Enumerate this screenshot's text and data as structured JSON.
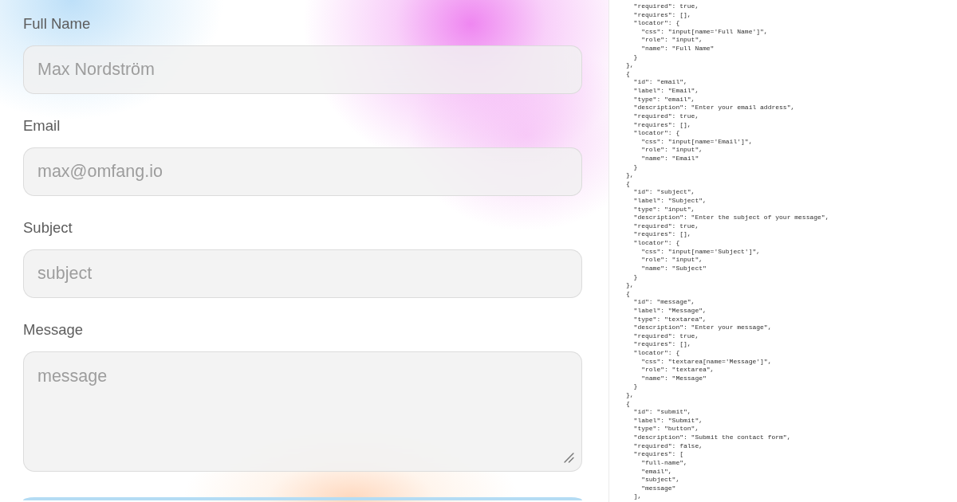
{
  "form": {
    "fields": [
      {
        "label": "Full Name",
        "kind": "input",
        "placeholder": "Max Nordström"
      },
      {
        "label": "Email",
        "kind": "input",
        "placeholder": "max@omfang.io"
      },
      {
        "label": "Subject",
        "kind": "input",
        "placeholder": "subject"
      },
      {
        "label": "Message",
        "kind": "textarea",
        "placeholder": "message"
      }
    ]
  },
  "code_panel": {
    "lines": [
      "  \"required\": true,",
      "  \"requires\": [],",
      "  \"locator\": {",
      "    \"css\": \"input[name='Full Name']\",",
      "    \"role\": \"input\",",
      "    \"name\": \"Full Name\"",
      "  }",
      "},",
      "{",
      "  \"id\": \"email\",",
      "  \"label\": \"Email\",",
      "  \"type\": \"email\",",
      "  \"description\": \"Enter your email address\",",
      "  \"required\": true,",
      "  \"requires\": [],",
      "  \"locator\": {",
      "    \"css\": \"input[name='Email']\",",
      "    \"role\": \"input\",",
      "    \"name\": \"Email\"",
      "  }",
      "},",
      "{",
      "  \"id\": \"subject\",",
      "  \"label\": \"Subject\",",
      "  \"type\": \"input\",",
      "  \"description\": \"Enter the subject of your message\",",
      "  \"required\": true,",
      "  \"requires\": [],",
      "  \"locator\": {",
      "    \"css\": \"input[name='Subject']\",",
      "    \"role\": \"input\",",
      "    \"name\": \"Subject\"",
      "  }",
      "},",
      "{",
      "  \"id\": \"message\",",
      "  \"label\": \"Message\",",
      "  \"type\": \"textarea\",",
      "  \"description\": \"Enter your message\",",
      "  \"required\": true,",
      "  \"requires\": [],",
      "  \"locator\": {",
      "    \"css\": \"textarea[name='Message']\",",
      "    \"role\": \"textarea\",",
      "    \"name\": \"Message\"",
      "  }",
      "},",
      "{",
      "  \"id\": \"submit\",",
      "  \"label\": \"Submit\",",
      "  \"type\": \"button\",",
      "  \"description\": \"Submit the contact form\",",
      "  \"required\": false,",
      "  \"requires\": [",
      "    \"full-name\",",
      "    \"email\",",
      "    \"subject\",",
      "    \"message\"",
      "  ],"
    ]
  }
}
